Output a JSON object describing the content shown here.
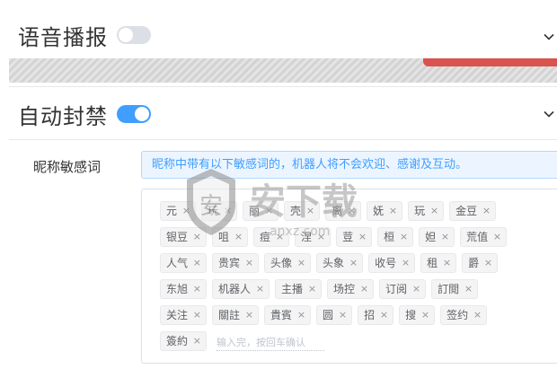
{
  "voice_broadcast": {
    "title": "语音播报",
    "enabled": false
  },
  "auto_ban": {
    "title": "自动封禁",
    "enabled": true,
    "field_label": "昵称敏感词",
    "tip": "昵称中带有以下敏感词的，机器人将不会欢迎、感谢及互动。",
    "tags": [
      "元",
      "玩",
      "丽",
      "壳",
      "离",
      "妩",
      "玩",
      "金豆",
      "银豆",
      "咀",
      "痘",
      "涅",
      "荳",
      "桓",
      "妲",
      "荒值",
      "人气",
      "贵宾",
      "头像",
      "头象",
      "收号",
      "租",
      "爵",
      "东旭",
      "机器人",
      "主播",
      "场控",
      "订阅",
      "訂閲",
      "关注",
      "關註",
      "貴賓",
      "圆",
      "招",
      "搜",
      "签约",
      "簽約"
    ],
    "close_glyph": "×",
    "input_placeholder": "输入完，按回车确认"
  },
  "watermark": {
    "text": "安下载",
    "sub": "anxz.com"
  },
  "colors": {
    "accent": "#409eff",
    "tip_bg": "#ecf5ff",
    "toggle_off": "#dcdfe6",
    "hatch_red": "#d9534f"
  },
  "icons": {
    "collapse": "chevron-down-icon",
    "tag_close": "close-icon"
  }
}
